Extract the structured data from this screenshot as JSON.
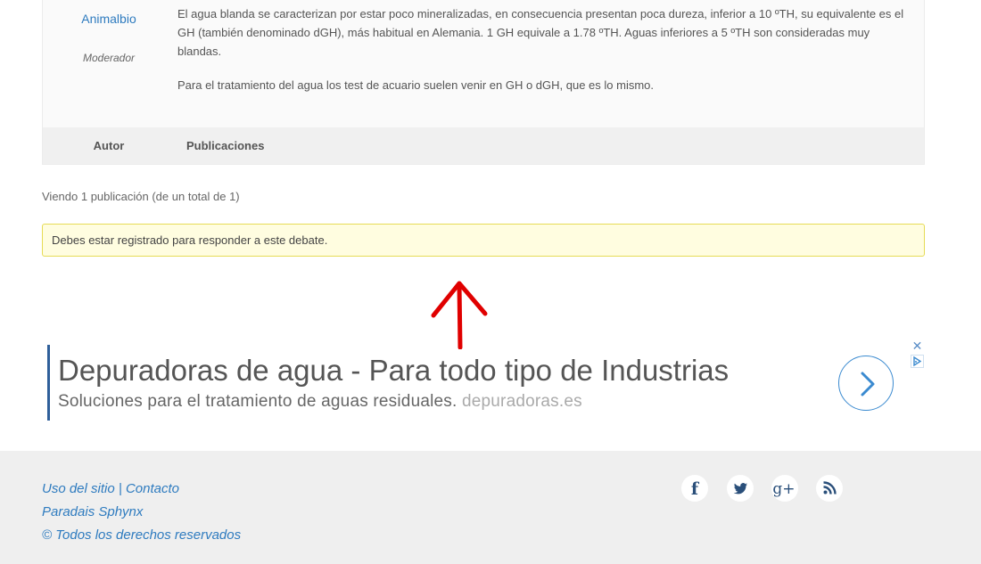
{
  "post": {
    "author_name": "Animalbio",
    "author_role": "Moderador",
    "paragraph_1": "El agua blanda se caracterizan por estar poco mineralizadas, en consecuencia presentan poca dureza, inferior a 10 ºTH, su equivalente es el GH (también denominado dGH), más habitual en Alemania. 1 GH equivale a 1.78 ºTH. Aguas inferiores a 5 ºTH son consideradas muy blandas.",
    "paragraph_2": "Para el tratamiento del agua los test de acuario suelen venir en GH o dGH, que es lo mismo."
  },
  "table_footer": {
    "author_label": "Autor",
    "posts_label": "Publicaciones"
  },
  "viewing_text": "Viendo 1 publicación (de un total de 1)",
  "notice_text": "Debes estar registrado para responder a este debate.",
  "ad": {
    "title": "Depuradoras de agua - Para todo tipo de Industrias",
    "description": "Soluciones para el tratamiento de aguas residuales.",
    "domain": "depuradoras.es",
    "close_glyph": "✕"
  },
  "footer": {
    "link_usage": "Uso del sitio",
    "separator": "|",
    "link_contact": "Contacto",
    "site_name": "Paradais Sphynx",
    "copyright": "© Todos los derechos reservados"
  },
  "social": [
    {
      "icon": "facebook-icon",
      "glyph": "f"
    },
    {
      "icon": "twitter-icon",
      "glyph": ""
    },
    {
      "icon": "google-plus-icon",
      "glyph": "g+"
    },
    {
      "icon": "rss-icon",
      "glyph": ""
    }
  ],
  "colors": {
    "link": "#2e7bbf",
    "notice_bg": "#fffde0",
    "notice_border": "#e6db55",
    "arrow": "#e00000",
    "footer_bg": "#efefef",
    "ad_bar": "#2f5f9a"
  }
}
